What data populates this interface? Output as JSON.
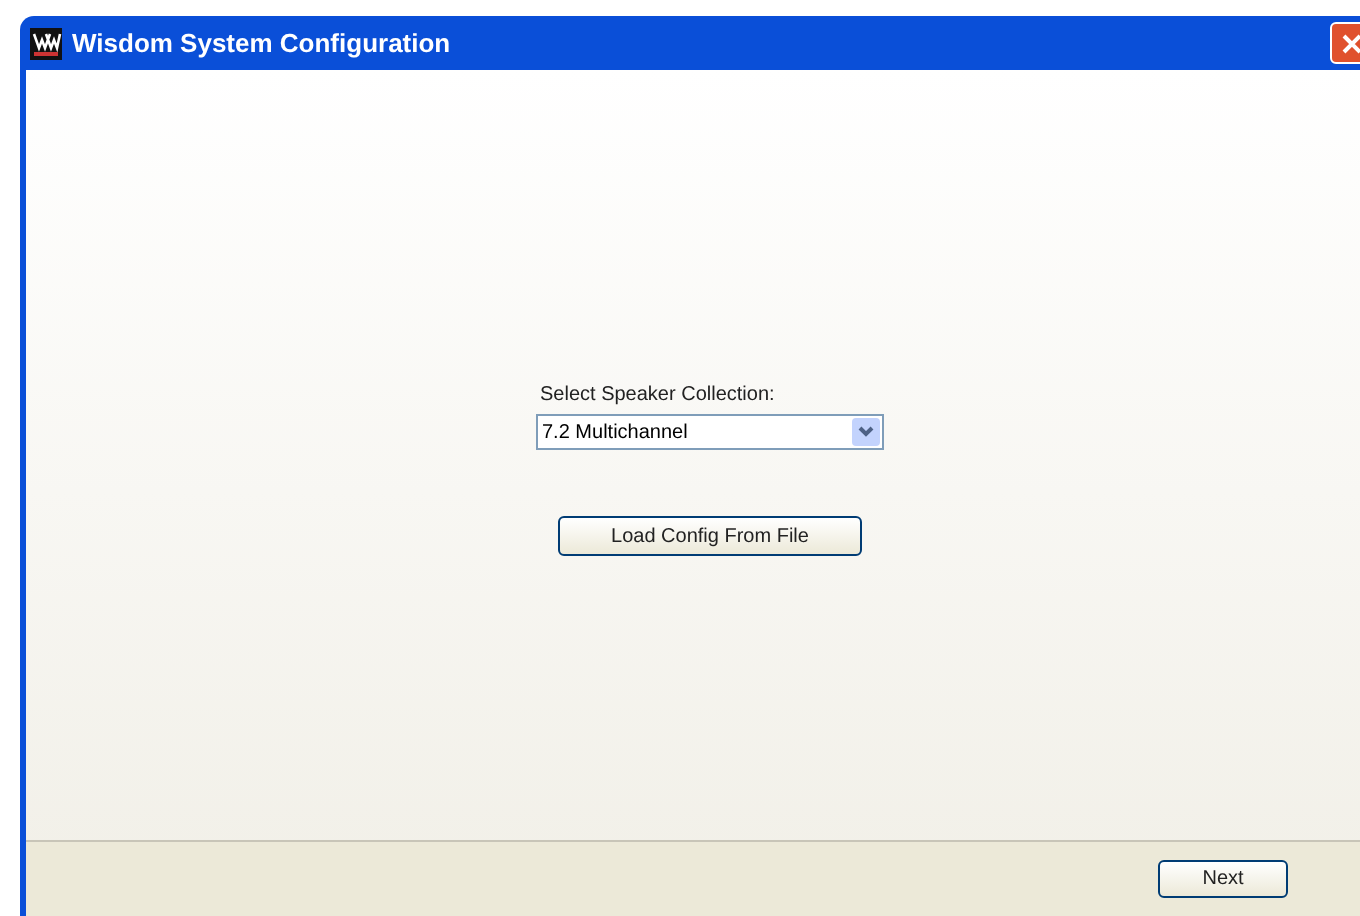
{
  "window": {
    "title": "Wisdom System Configuration"
  },
  "speaker_collection": {
    "label": "Select Speaker Collection:",
    "value": "7.2 Multichannel"
  },
  "buttons": {
    "load": "Load Config From File",
    "next": "Next"
  }
}
